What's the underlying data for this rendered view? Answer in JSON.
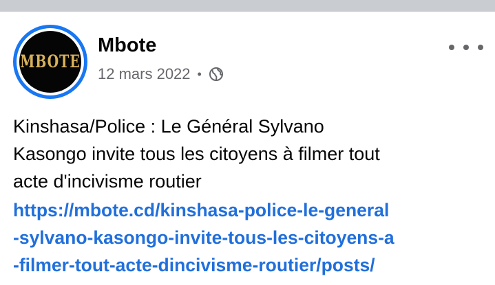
{
  "post": {
    "page_name": "Mbote",
    "avatar_text": "MBOTE",
    "date": "12 mars 2022",
    "separator": "•",
    "privacy_icon": "globe-icon",
    "more_icon": "more-options-icon",
    "text_lines": [
      "Kinshasa/Police : Le Général Sylvano",
      "Kasongo invite tous les citoyens à filmer tout",
      "acte d'incivisme routier"
    ],
    "link_lines": [
      "https://mbote.cd/kinshasa-police-le-general",
      "-sylvano-kasongo-invite-tous-les-citoyens-a",
      "-filmer-tout-acte-dincivisme-routier/posts/"
    ]
  },
  "colors": {
    "accent": "#1877f2",
    "link": "#216fdb",
    "secondary_text": "#65676b",
    "logo_gold": "#d8b15a"
  }
}
